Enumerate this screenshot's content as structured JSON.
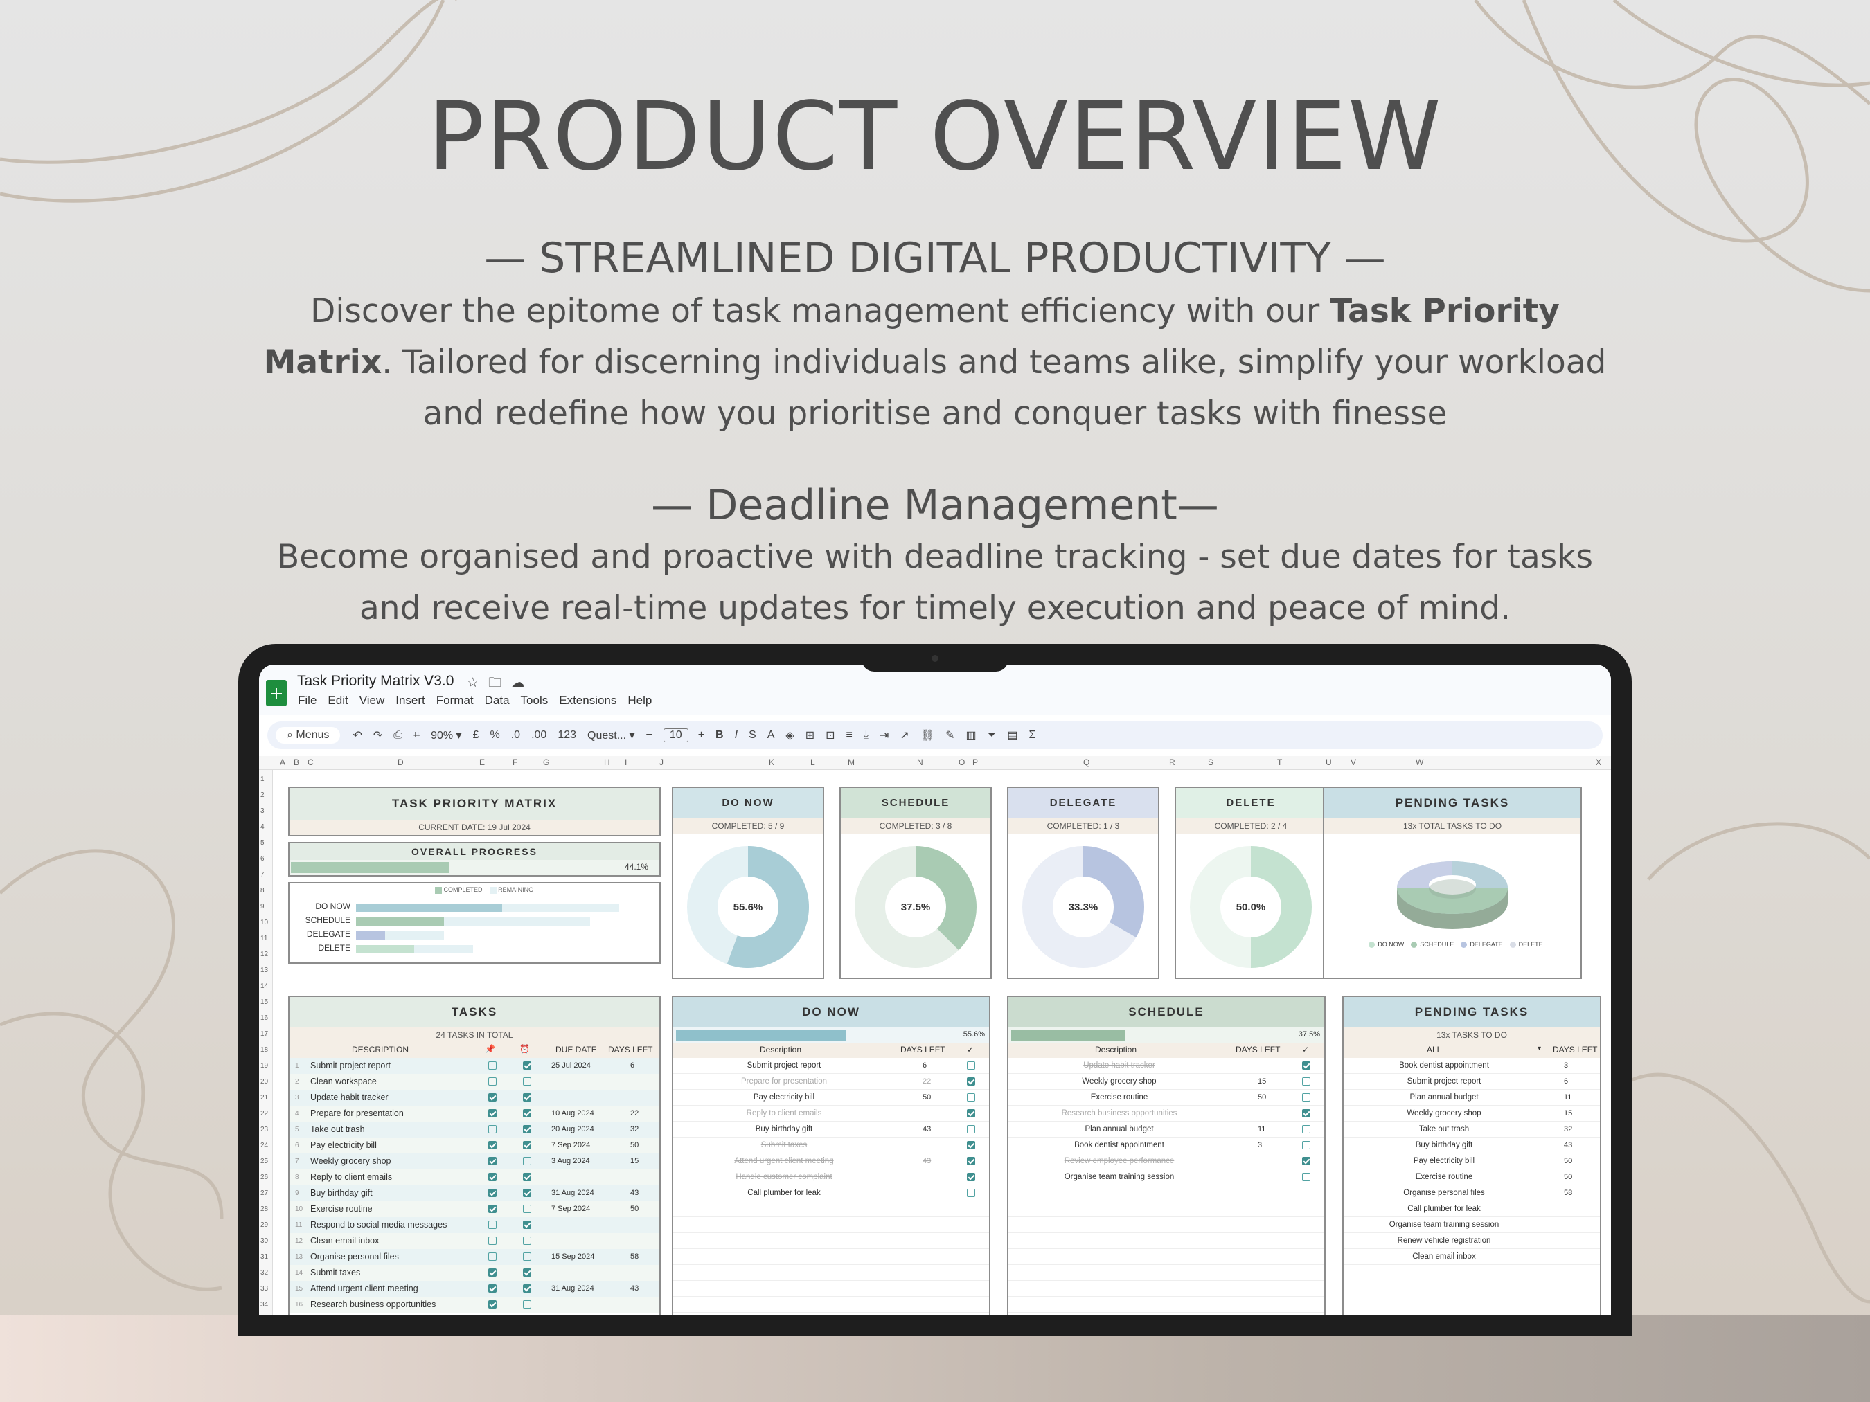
{
  "page": {
    "title": "PRODUCT OVERVIEW",
    "section1": {
      "heading": "— STREAMLINED DIGITAL PRODUCTIVITY —",
      "text_before": "Discover the epitome of task management efficiency with our ",
      "bold": "Task Priority Matrix",
      "text_after": ". Tailored for discerning individuals and teams alike, simplify your workload and redefine how you prioritise and conquer tasks with finesse"
    },
    "section2": {
      "heading": "— Deadline Management—",
      "text": "Become organised and proactive with deadline tracking - set due dates for tasks and receive real-time updates for timely execution and peace of mind."
    }
  },
  "colors": {
    "accent_green": "#a9cbb3",
    "accent_blue": "#a8cdd6",
    "accent_lavender": "#b7c4e0",
    "accent_mint": "#c4e2d0",
    "sheets_green": "#1e8e3e"
  },
  "sheet": {
    "doc_title": "Task Priority Matrix V3.0",
    "title_icons": [
      "star-icon",
      "folder-move-icon",
      "cloud-status-icon"
    ],
    "menu": [
      "File",
      "Edit",
      "View",
      "Insert",
      "Format",
      "Data",
      "Tools",
      "Extensions",
      "Help"
    ],
    "toolbar": {
      "menus": "Menus",
      "zoom": "90%",
      "currency": "£",
      "percent": "%",
      "dec_minus": ".0",
      "dec_plus": ".00",
      "number_fmt": "123",
      "font": "Quest...",
      "font_size": "10",
      "bold": "B",
      "italic": "I",
      "strike": "S",
      "text_color": "A"
    },
    "columns": [
      "A",
      "B",
      "C",
      "D",
      "E",
      "F",
      "G",
      "H",
      "I",
      "J",
      "K",
      "L",
      "M",
      "N",
      "O",
      "P",
      "Q",
      "R",
      "S",
      "T",
      "U",
      "V",
      "W",
      "X"
    ],
    "rows": [
      "1",
      "2",
      "3",
      "4",
      "5",
      "6",
      "7",
      "8",
      "9",
      "10",
      "11",
      "12",
      "13",
      "14",
      "15",
      "16",
      "17",
      "18",
      "19",
      "20",
      "21",
      "22",
      "23",
      "24",
      "25",
      "26",
      "27",
      "28",
      "29",
      "30",
      "31",
      "32",
      "33",
      "34"
    ],
    "matrix": {
      "title": "TASK PRIORITY MATRIX",
      "date": "CURRENT DATE: 19 Jul 2024"
    },
    "progress": {
      "title": "OVERALL PROGRESS",
      "value": "44.1%",
      "fraction": 0.441
    },
    "legend": {
      "completed": "COMPLETED",
      "remaining": "REMAINING"
    },
    "quadrant_bars": [
      {
        "label": "DO NOW",
        "completed": 5,
        "total": 9
      },
      {
        "label": "SCHEDULE",
        "completed": 3,
        "total": 8
      },
      {
        "label": "DELEGATE",
        "completed": 1,
        "total": 3
      },
      {
        "label": "DELETE",
        "completed": 2,
        "total": 4
      }
    ],
    "quadrants": [
      {
        "title": "DO NOW",
        "completed": "COMPLETED: 5 / 9",
        "pct": "55.6%",
        "value": 0.556,
        "color": "#a8cdd6",
        "bg": "#e4f1f4"
      },
      {
        "title": "SCHEDULE",
        "completed": "COMPLETED: 3 / 8",
        "pct": "37.5%",
        "value": 0.375,
        "color": "#a9cbb3",
        "bg": "#e6efe8"
      },
      {
        "title": "DELEGATE",
        "completed": "COMPLETED: 1 / 3",
        "pct": "33.3%",
        "value": 0.333,
        "color": "#b7c4e0",
        "bg": "#eaeef6"
      },
      {
        "title": "DELETE",
        "completed": "COMPLETED: 2 / 4",
        "pct": "50.0%",
        "value": 0.5,
        "color": "#c4e2d0",
        "bg": "#edf6f0"
      }
    ],
    "pending": {
      "title": "PENDING TASKS",
      "total": "13x TOTAL TASKS TO DO",
      "legend": [
        "DO NOW",
        "SCHEDULE",
        "DELEGATE",
        "DELETE"
      ]
    },
    "tasks": {
      "title": "TASKS",
      "count": "24 TASKS IN TOTAL",
      "headers": {
        "description": "DESCRIPTION",
        "due": "DUE DATE",
        "days": "DAYS LEFT"
      },
      "items": [
        {
          "n": "1",
          "d": "Submit project report",
          "c1": false,
          "c2": true,
          "due": "25 Jul 2024",
          "days": "6"
        },
        {
          "n": "2",
          "d": "Clean workspace",
          "c1": false,
          "c2": false,
          "due": "",
          "days": ""
        },
        {
          "n": "3",
          "d": "Update habit tracker",
          "c1": true,
          "c2": true,
          "due": "",
          "days": ""
        },
        {
          "n": "4",
          "d": "Prepare for presentation",
          "c1": true,
          "c2": true,
          "due": "10 Aug 2024",
          "days": "22"
        },
        {
          "n": "5",
          "d": "Take out trash",
          "c1": false,
          "c2": true,
          "due": "20 Aug 2024",
          "days": "32"
        },
        {
          "n": "6",
          "d": "Pay electricity bill",
          "c1": true,
          "c2": true,
          "due": "7 Sep 2024",
          "days": "50"
        },
        {
          "n": "7",
          "d": "Weekly grocery shop",
          "c1": true,
          "c2": false,
          "due": "3 Aug 2024",
          "days": "15"
        },
        {
          "n": "8",
          "d": "Reply to client emails",
          "c1": true,
          "c2": true,
          "due": "",
          "days": ""
        },
        {
          "n": "9",
          "d": "Buy birthday gift",
          "c1": true,
          "c2": true,
          "due": "31 Aug 2024",
          "days": "43"
        },
        {
          "n": "10",
          "d": "Exercise routine",
          "c1": true,
          "c2": false,
          "due": "7 Sep 2024",
          "days": "50"
        },
        {
          "n": "11",
          "d": "Respond to social media messages",
          "c1": false,
          "c2": true,
          "due": "",
          "days": ""
        },
        {
          "n": "12",
          "d": "Clean email inbox",
          "c1": false,
          "c2": false,
          "due": "",
          "days": ""
        },
        {
          "n": "13",
          "d": "Organise personal files",
          "c1": false,
          "c2": false,
          "due": "15 Sep 2024",
          "days": "58"
        },
        {
          "n": "14",
          "d": "Submit taxes",
          "c1": true,
          "c2": true,
          "due": "",
          "days": ""
        },
        {
          "n": "15",
          "d": "Attend urgent client meeting",
          "c1": true,
          "c2": true,
          "due": "31 Aug 2024",
          "days": "43"
        },
        {
          "n": "16",
          "d": "Research business opportunities",
          "c1": true,
          "c2": false,
          "due": "",
          "days": ""
        }
      ]
    },
    "donow_list": {
      "title": "DO NOW",
      "pct": "55.6%",
      "value": 0.556,
      "headers": {
        "description": "Description",
        "days": "DAYS LEFT",
        "check": "✓"
      },
      "items": [
        {
          "d": "Submit project report",
          "days": "6",
          "done": false
        },
        {
          "d": "Prepare for presentation",
          "days": "22",
          "done": true
        },
        {
          "d": "Pay electricity bill",
          "days": "50",
          "done": false
        },
        {
          "d": "Reply to client emails",
          "days": "",
          "done": true
        },
        {
          "d": "Buy birthday gift",
          "days": "43",
          "done": false
        },
        {
          "d": "Submit taxes",
          "days": "",
          "done": true
        },
        {
          "d": "Attend urgent client meeting",
          "days": "43",
          "done": true
        },
        {
          "d": "Handle customer complaint",
          "days": "",
          "done": true
        },
        {
          "d": "Call plumber for leak",
          "days": "",
          "done": false
        }
      ]
    },
    "schedule_list": {
      "title": "SCHEDULE",
      "pct": "37.5%",
      "value": 0.375,
      "headers": {
        "description": "Description",
        "days": "DAYS LEFT",
        "check": "✓"
      },
      "items": [
        {
          "d": "Update habit tracker",
          "days": "",
          "done": true
        },
        {
          "d": "Weekly grocery shop",
          "days": "15",
          "done": false
        },
        {
          "d": "Exercise routine",
          "days": "50",
          "done": false
        },
        {
          "d": "Research business opportunities",
          "days": "",
          "done": true
        },
        {
          "d": "Plan annual budget",
          "days": "11",
          "done": false
        },
        {
          "d": "Book dentist appointment",
          "days": "3",
          "done": false
        },
        {
          "d": "Review employee performance",
          "days": "",
          "done": true
        },
        {
          "d": "Organise team training session",
          "days": "",
          "done": false
        }
      ]
    },
    "pending_list": {
      "title": "PENDING TASKS",
      "count": "13x TASKS TO DO",
      "headers": {
        "filter": "ALL",
        "days": "DAYS LEFT"
      },
      "items": [
        {
          "d": "Book dentist appointment",
          "days": "3"
        },
        {
          "d": "Submit project report",
          "days": "6"
        },
        {
          "d": "Plan annual budget",
          "days": "11"
        },
        {
          "d": "Weekly grocery shop",
          "days": "15"
        },
        {
          "d": "Take out trash",
          "days": "32"
        },
        {
          "d": "Buy birthday gift",
          "days": "43"
        },
        {
          "d": "Pay electricity bill",
          "days": "50"
        },
        {
          "d": "Exercise routine",
          "days": "50"
        },
        {
          "d": "Organise personal files",
          "days": "58"
        },
        {
          "d": "Call plumber for leak",
          "days": ""
        },
        {
          "d": "Organise team training session",
          "days": ""
        },
        {
          "d": "Renew vehicle registration",
          "days": ""
        },
        {
          "d": "Clean email inbox",
          "days": ""
        }
      ]
    }
  }
}
